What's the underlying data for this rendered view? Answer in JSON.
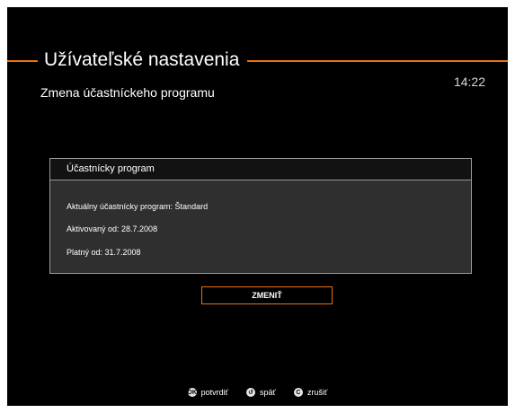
{
  "header": {
    "title": "Užívateľské nastavenia",
    "subtitle": "Zmena účastníckeho programu",
    "clock": "14:22",
    "accent_color": "#e8700f"
  },
  "panel": {
    "title": "Účastnícky program",
    "rows": [
      "Aktuálny účastnícky program: Štandard",
      "Aktivovaný od: 28.7.2008",
      "Platný od: 31.7.2008"
    ]
  },
  "actions": {
    "change_label": "ZMENIŤ"
  },
  "footer": {
    "hints": [
      {
        "icon": "ok-key-icon",
        "label": "potvrdiť"
      },
      {
        "icon": "back-key-icon",
        "label": "späť"
      },
      {
        "icon": "cancel-key-icon",
        "label": "zrušiť"
      }
    ]
  }
}
